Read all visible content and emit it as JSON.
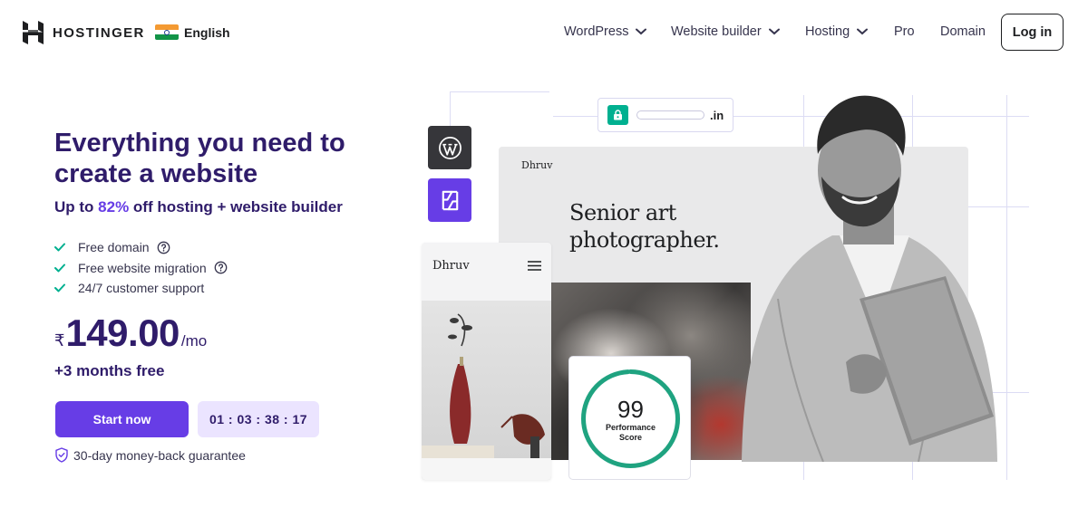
{
  "header": {
    "brand": "HOSTINGER",
    "language": "English",
    "nav": [
      {
        "label": "WordPress",
        "has_dropdown": true
      },
      {
        "label": "Website builder",
        "has_dropdown": true
      },
      {
        "label": "Hosting",
        "has_dropdown": true
      },
      {
        "label": "Pro",
        "has_dropdown": false
      },
      {
        "label": "Domain",
        "has_dropdown": false
      }
    ],
    "login_label": "Log in"
  },
  "hero": {
    "title": "Everything you need to create a website",
    "subtitle_prefix": "Up to ",
    "subtitle_percent": "82%",
    "subtitle_suffix": " off hosting + website builder",
    "features": [
      {
        "label": "Free domain",
        "has_help": true
      },
      {
        "label": "Free website migration",
        "has_help": true
      },
      {
        "label": "24/7 customer support",
        "has_help": false
      }
    ],
    "price": {
      "currency": "₹",
      "amount": "149.00",
      "period": "/mo"
    },
    "bonus": "+3 months free",
    "cta_label": "Start now",
    "timer": "01 : 03 : 38 : 17",
    "guarantee": "30-day money-back guarantee"
  },
  "illustration": {
    "url_tld": ".in",
    "desktop_brand": "Dhruv",
    "desktop_headline": "Senior art photographer.",
    "mobile_brand": "Dhruv",
    "score_value": "99",
    "score_label_line1": "Performance",
    "score_label_line2": "Score",
    "score_fraction": 0.99
  },
  "colors": {
    "primary": "#673de6",
    "navy": "#2f1c6a",
    "success": "#00b090",
    "timer_bg": "#ebe4ff"
  }
}
